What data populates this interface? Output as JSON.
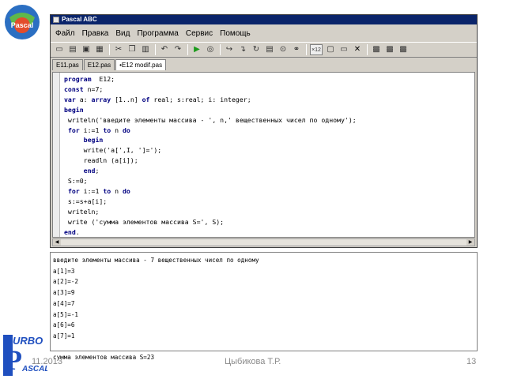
{
  "window": {
    "title": "Pascal ABC"
  },
  "menu": [
    "Файл",
    "Правка",
    "Вид",
    "Программа",
    "Сервис",
    "Помощь"
  ],
  "toolbar": [
    {
      "icon": "new-file-icon",
      "glyph": "▭"
    },
    {
      "icon": "open-folder-icon",
      "glyph": "▤"
    },
    {
      "icon": "save-icon",
      "glyph": "▣"
    },
    {
      "icon": "save-all-icon",
      "glyph": "▦"
    },
    {
      "icon": "cut-icon",
      "glyph": "✂"
    },
    {
      "icon": "copy-icon",
      "glyph": "❐"
    },
    {
      "icon": "paste-icon",
      "glyph": "▥"
    },
    {
      "icon": "undo-icon",
      "glyph": "↶"
    },
    {
      "icon": "redo-icon",
      "glyph": "↷"
    },
    {
      "icon": "run-icon",
      "glyph": "▶"
    },
    {
      "icon": "compile-icon",
      "glyph": "◎"
    },
    {
      "icon": "step-over-icon",
      "glyph": "↪"
    },
    {
      "icon": "step-into-icon",
      "glyph": "↴"
    },
    {
      "icon": "step-out-icon",
      "glyph": "↻"
    },
    {
      "icon": "watch-icon",
      "glyph": "▤"
    },
    {
      "icon": "breakpoint-icon",
      "glyph": "⊙"
    },
    {
      "icon": "debug-icon",
      "glyph": "⚭"
    },
    {
      "icon": "calc-toggle-icon",
      "glyph": "×12"
    },
    {
      "icon": "window-icon",
      "glyph": "▢"
    },
    {
      "icon": "program-icon",
      "glyph": "▭"
    },
    {
      "icon": "close-icon",
      "glyph": "✕"
    },
    {
      "icon": "form-icon",
      "glyph": "▩"
    },
    {
      "icon": "form-run-icon",
      "glyph": "▩"
    },
    {
      "icon": "form-edit-icon",
      "glyph": "▩"
    }
  ],
  "tabs": [
    "E11.pas",
    "E12.pas",
    "•E12 modif.pas"
  ],
  "active_tab": 2,
  "code_lines": [
    [
      [
        "kw",
        "program"
      ],
      [
        "",
        "  E12;"
      ]
    ],
    [
      [
        "kw",
        "const"
      ],
      [
        "",
        " n=7;"
      ]
    ],
    [
      [
        "kw",
        "var"
      ],
      [
        "",
        " a: "
      ],
      [
        "kw",
        "array"
      ],
      [
        "",
        " [1..n] "
      ],
      [
        "kw",
        "of"
      ],
      [
        "",
        " real; s:real; i: integer;"
      ]
    ],
    [
      [
        "kw",
        "begin"
      ]
    ],
    [
      [
        "",
        " writeln('введите элементы массива - ', n,' вещественных чисел по одному');"
      ]
    ],
    [
      [
        "",
        " "
      ],
      [
        "kw",
        "for"
      ],
      [
        "",
        " i:=1 "
      ],
      [
        "kw",
        "to"
      ],
      [
        "",
        " n "
      ],
      [
        "kw",
        "do"
      ]
    ],
    [
      [
        "",
        "     "
      ],
      [
        "kw",
        "begin"
      ]
    ],
    [
      [
        "",
        "     write('a[',I, ']=');"
      ]
    ],
    [
      [
        "",
        "     readln (a[i]);"
      ]
    ],
    [
      [
        "",
        "     "
      ],
      [
        "kw",
        "end"
      ],
      [
        "",
        ";"
      ]
    ],
    [
      [
        "",
        " S:=0;"
      ]
    ],
    [
      [
        "",
        " "
      ],
      [
        "kw",
        "for"
      ],
      [
        "",
        " i:=1 "
      ],
      [
        "kw",
        "to"
      ],
      [
        "",
        " n "
      ],
      [
        "kw",
        "do"
      ]
    ],
    [
      [
        "",
        " s:=s+a[i];"
      ]
    ],
    [
      [
        "",
        " writeln;"
      ]
    ],
    [
      [
        "",
        " write ('сумма элементов массива S=', S);"
      ]
    ],
    [
      [
        "kw",
        "end"
      ],
      [
        "",
        "."
      ]
    ]
  ],
  "output_lines": [
    "введите элементы массива - 7 вещественных чисел по одному",
    "a[1]=3",
    "a[2]=-2",
    "a[3]=9",
    "a[4]=7",
    "a[5]=-1",
    "a[6]=6",
    "a[7]=1",
    "",
    "сумма элементов массива S=23"
  ],
  "footer": {
    "date": "11.2013",
    "author": "Цыбикова Т.Р.",
    "page": "13"
  },
  "logo_top_text": "Pascal",
  "logo_bottom_text": "TURBO PASCAL",
  "colors": {
    "titlebar": "#0a246a",
    "window": "#d4d0c8",
    "keyword": "#000080"
  }
}
